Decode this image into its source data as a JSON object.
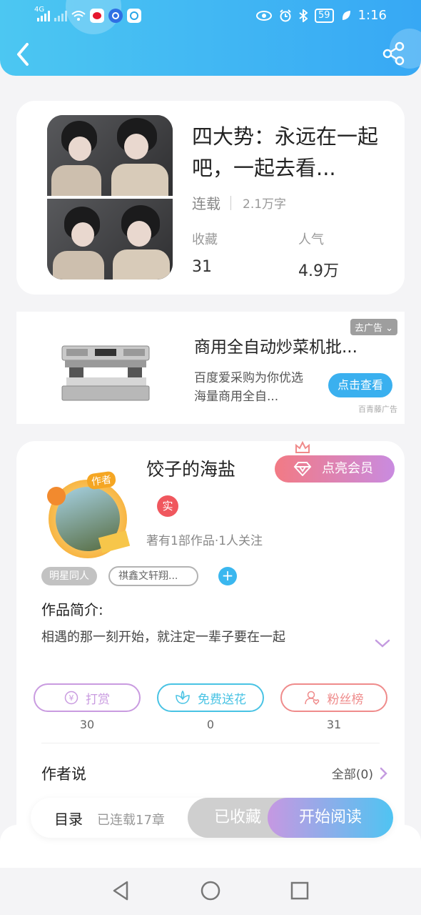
{
  "status_bar": {
    "network": "4G",
    "time": "1:16",
    "battery": "59"
  },
  "header": {
    "back_icon": "chevron-left-icon",
    "share_icon": "share-icon"
  },
  "book": {
    "title": "四大势：永远在一起吧，一起去看...",
    "status": "连载",
    "word_count": "2.1万字",
    "favorites_label": "收藏",
    "favorites_value": "31",
    "popularity_label": "人气",
    "popularity_value": "4.9万"
  },
  "ad": {
    "remove_label": "去广告",
    "title": "商用全自动炒菜机批...",
    "description": "百度爱采购为你优选海量商用全自...",
    "cta": "点击查看",
    "source": "百青藤广告"
  },
  "author": {
    "tag": "作者",
    "name": "饺子的海盐",
    "vip_button": "点亮会员",
    "real_badge": "实",
    "stats": "著有1部作品·1人关注",
    "tags": [
      "明星同人",
      "祺鑫文轩翔..."
    ],
    "intro_title": "作品简介:",
    "intro_text": "相遇的那一刻开始，就注定一辈子要在一起"
  },
  "actions": [
    {
      "label": "打赏",
      "count": "30",
      "color": "#c99be0"
    },
    {
      "label": "免费送花",
      "count": "0",
      "color": "#49c3e4"
    },
    {
      "label": "粉丝榜",
      "count": "31",
      "color": "#ef8b8b"
    }
  ],
  "author_says": {
    "title": "作者说",
    "all_label": "全部(0)"
  },
  "bottom_bar": {
    "toc": "目录",
    "chapters": "已连载17章",
    "collected": "已收藏",
    "start_reading": "开始阅读"
  }
}
